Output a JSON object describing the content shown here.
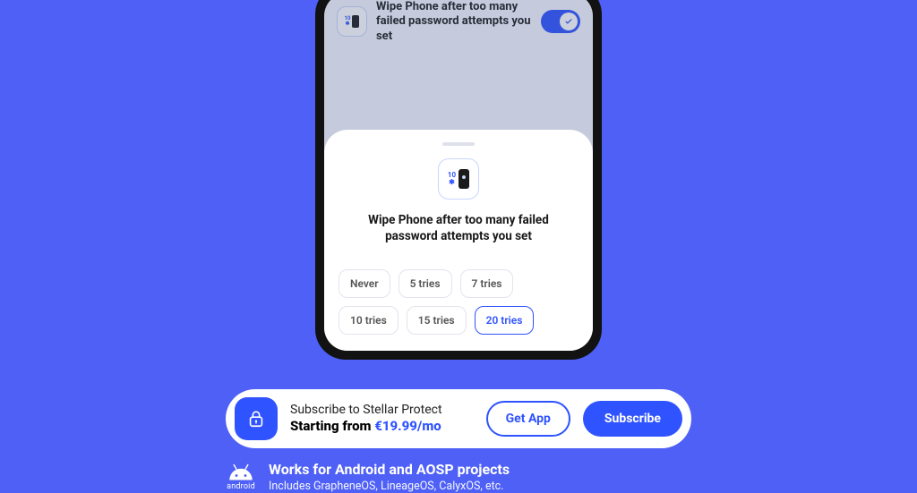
{
  "setting_row": {
    "label": "Wipe Phone after too many failed password attempts you set",
    "icon_badge_top": "10",
    "icon_badge_bottom": "✱",
    "toggle_on": true
  },
  "sheet": {
    "icon_badge_top": "10",
    "icon_badge_bottom": "✱",
    "title": "Wipe Phone after too many failed password attempts you set",
    "options": [
      "Never",
      "5 tries",
      "7 tries",
      "10 tries",
      "15 tries",
      "20 tries"
    ],
    "selected_index": 5
  },
  "subscribe": {
    "line1": "Subscribe to Stellar Protect",
    "line2_prefix": "Starting from ",
    "price": "€19.99/mo",
    "get_app_label": "Get App",
    "subscribe_label": "Subscribe"
  },
  "footer": {
    "icon_label": "android",
    "title": "Works for Android and AOSP projects",
    "subtitle": "Includes GrapheneOS, LineageOS, CalyxOS, etc."
  }
}
